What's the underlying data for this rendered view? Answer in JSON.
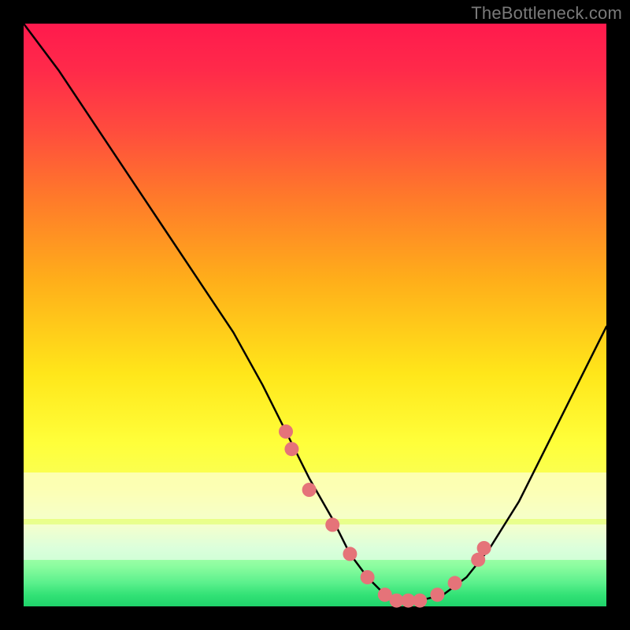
{
  "watermark": "TheBottleneck.com",
  "chart_data": {
    "type": "line",
    "title": "",
    "xlabel": "",
    "ylabel": "",
    "xlim": [
      0,
      100
    ],
    "ylim": [
      0,
      100
    ],
    "grid": false,
    "legend": false,
    "series": [
      {
        "name": "bottleneck-curve",
        "x": [
          0,
          6,
          12,
          18,
          24,
          30,
          36,
          41,
          45,
          49,
          53,
          56,
          59,
          62,
          65,
          68,
          72,
          76,
          80,
          85,
          90,
          95,
          100
        ],
        "y": [
          100,
          92,
          83,
          74,
          65,
          56,
          47,
          38,
          30,
          22,
          15,
          9,
          5,
          2,
          1,
          1,
          2,
          5,
          10,
          18,
          28,
          38,
          48
        ]
      }
    ],
    "markers": {
      "name": "highlighted-points",
      "x": [
        45,
        46,
        49,
        53,
        56,
        59,
        62,
        64,
        66,
        68,
        71,
        74,
        78,
        79
      ],
      "y": [
        30,
        27,
        20,
        14,
        9,
        5,
        2,
        1,
        1,
        1,
        2,
        4,
        8,
        10
      ]
    },
    "near_bottom_bands": [
      {
        "y": 15,
        "h": 8
      },
      {
        "y": 8,
        "h": 6
      }
    ]
  }
}
